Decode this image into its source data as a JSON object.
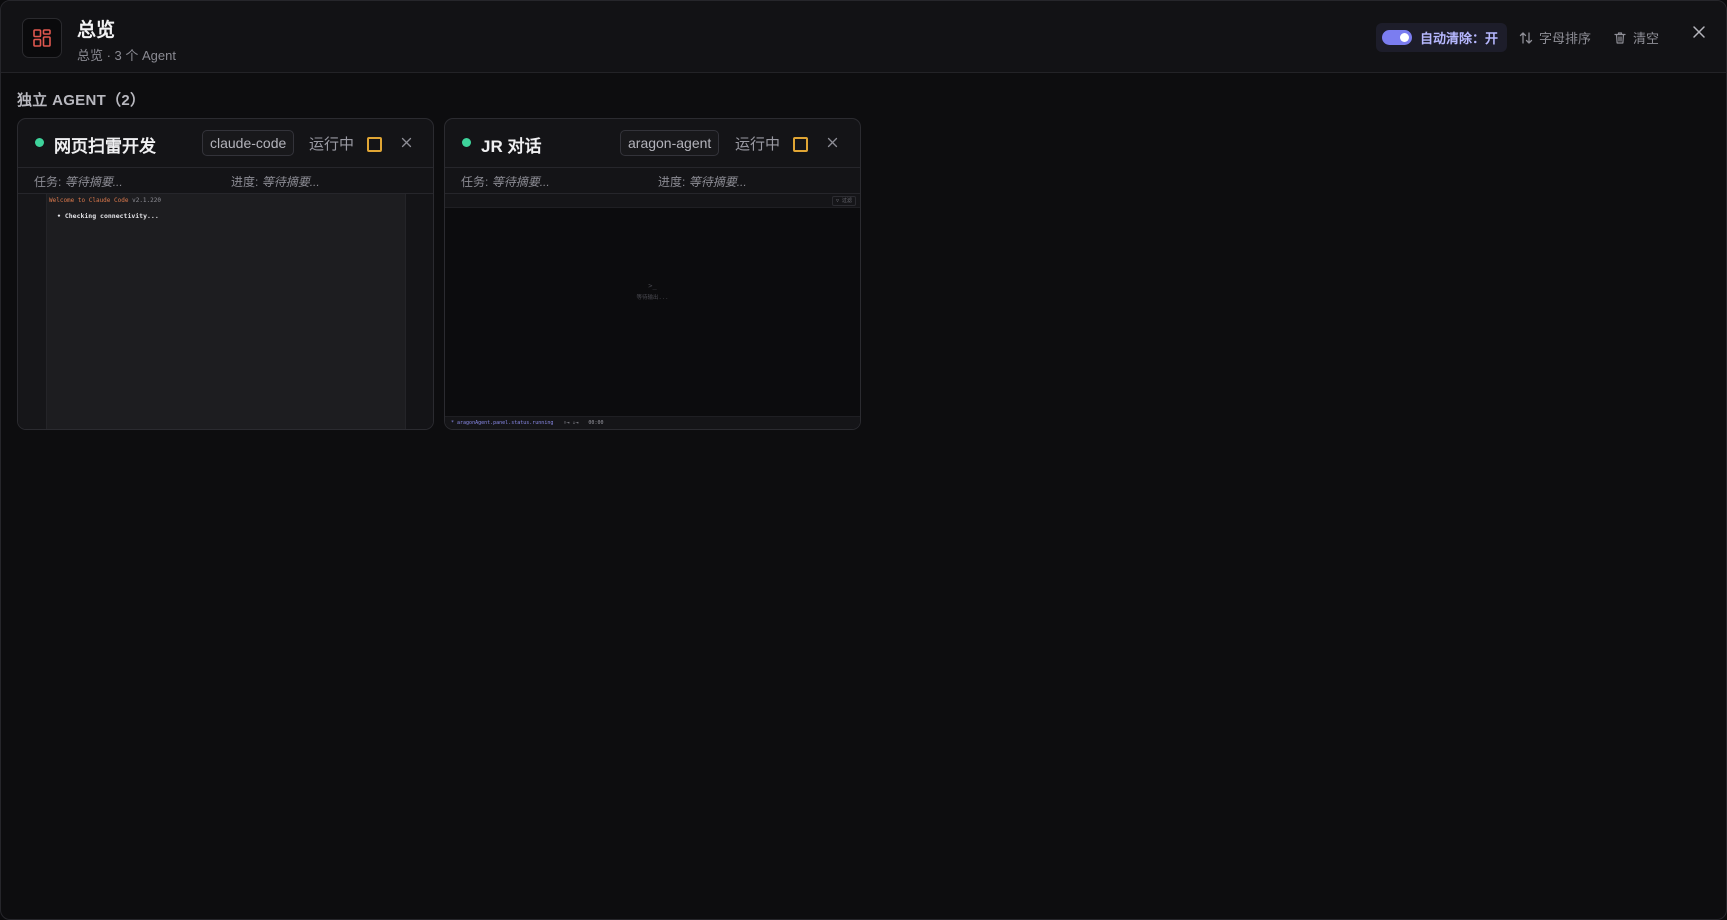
{
  "header": {
    "title": "总览",
    "subtitle": "总览 · 3 个 Agent",
    "auto_clear_label": "自动清除：开",
    "sort_label": "字母排序",
    "clear_label": "清空"
  },
  "section": {
    "title": "独立 AGENT（2）"
  },
  "cards": [
    {
      "name": "网页扫雷开发",
      "tag": "claude-code",
      "status": "运行中",
      "task_label": "任务:",
      "task_value": "等待摘要...",
      "progress_label": "进度:",
      "progress_value": "等待摘要...",
      "terminal_welcome": "Welcome to Claude Code",
      "terminal_version": " v2.1.220",
      "terminal_line": "• Checking connectivity..."
    },
    {
      "name": "JR 对话",
      "tag": "aragon-agent",
      "status": "运行中",
      "task_label": "任务:",
      "task_value": "等待摘要...",
      "progress_label": "进度:",
      "progress_value": "等待摘要...",
      "terminal_topbar": "▽ 过滤",
      "terminal_prompt": ">_",
      "terminal_wait": "等待输出...",
      "footer_status": "* aragonAgent.panel.status.running",
      "footer_mid": "↑⇥ ↓⇥",
      "footer_time": "00:00"
    }
  ],
  "colors": {
    "accent": "#7b7df0",
    "running_dot": "#3ed39b",
    "stop": "#e0a534",
    "app_icon": "#e0574f"
  }
}
